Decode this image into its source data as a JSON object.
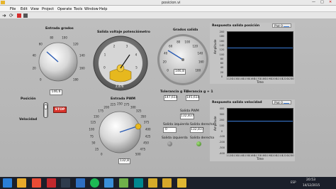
{
  "window": {
    "title": "posicion.vi"
  },
  "menu": [
    "File",
    "Edit",
    "View",
    "Project",
    "Operate",
    "Tools",
    "Window",
    "Help"
  ],
  "knob_entrada": {
    "label": "Entrada grados",
    "value": "146,6",
    "ticks": [
      "0",
      "20",
      "40",
      "60",
      "80",
      "100",
      "120",
      "140",
      "160",
      "180"
    ]
  },
  "gauge_voltaje": {
    "label": "Salida voltaje potenciómetro",
    "value": "2,476",
    "ticks": [
      "0",
      "1",
      "2",
      "3",
      "4",
      "5"
    ]
  },
  "gauge_grados": {
    "label": "Grados salida",
    "value": "146,8",
    "ticks": [
      "0",
      "20",
      "40",
      "60",
      "80",
      "100",
      "120",
      "140",
      "160",
      "180"
    ]
  },
  "tolerancias": {
    "minus_label": "Tolerancia g - 1",
    "plus_label": "Tolerancia g + 1",
    "minus_value": "147,614",
    "plus_value": "145,614"
  },
  "chart_pos": {
    "title": "Respuesta salida posición",
    "legend": "Plot 0",
    "ylabel": "Amplitude",
    "xlabel": "Time",
    "yticks": [
      "200",
      "180",
      "160",
      "140",
      "120",
      "100",
      "80",
      "60",
      "40",
      "20",
      "0"
    ],
    "xticks": [
      "1120",
      "1130",
      "1140",
      "1150",
      "1160",
      "1170",
      "1180",
      "1190",
      "1200",
      "1210",
      "1220",
      "1230"
    ]
  },
  "chart_vel": {
    "title": "Respuesta salida velocidad",
    "legend": "Plot 0",
    "ylabel": "Amplitude",
    "xlabel": "Time",
    "yticks": [
      "400",
      "300",
      "200",
      "100",
      "0",
      "-100",
      "-200",
      "-300",
      "-400"
    ],
    "xticks": [
      "1120",
      "1130",
      "1140",
      "1150",
      "1160",
      "1170",
      "1180",
      "1190",
      "1200",
      "1210",
      "1220",
      "1230"
    ]
  },
  "pwm": {
    "label": "Entrada PWM",
    "value": "132,8",
    "ticks": [
      "0",
      "25",
      "50",
      "75",
      "100",
      "125",
      "150",
      "175",
      "200",
      "225",
      "250",
      "275",
      "300",
      "325",
      "350",
      "375",
      "400",
      "425",
      "450",
      "475",
      "500"
    ]
  },
  "salida_pwm": {
    "label": "Salida PWM",
    "value": "132,837"
  },
  "salida_izquierda": {
    "label": "Salida izquierda",
    "value": "0"
  },
  "salida_derecha": {
    "label": "Salida derecha",
    "value": "132,837"
  },
  "led_izquierda": {
    "label": "Salida izquierda"
  },
  "led_derecha": {
    "label": "Salida derecha"
  },
  "selector": {
    "top_label": "Posición",
    "bottom_label": "Velocidad"
  },
  "stop_button": {
    "label": "STOP"
  },
  "taskbar": {
    "time": "20:53",
    "date": "14/12/2015",
    "lang": "ESP"
  },
  "colors": {
    "plot_line": "#3c7dd9",
    "plot_bg": "#000000",
    "stop_red": "#d8332b",
    "led_green": "#4a8d2a"
  }
}
